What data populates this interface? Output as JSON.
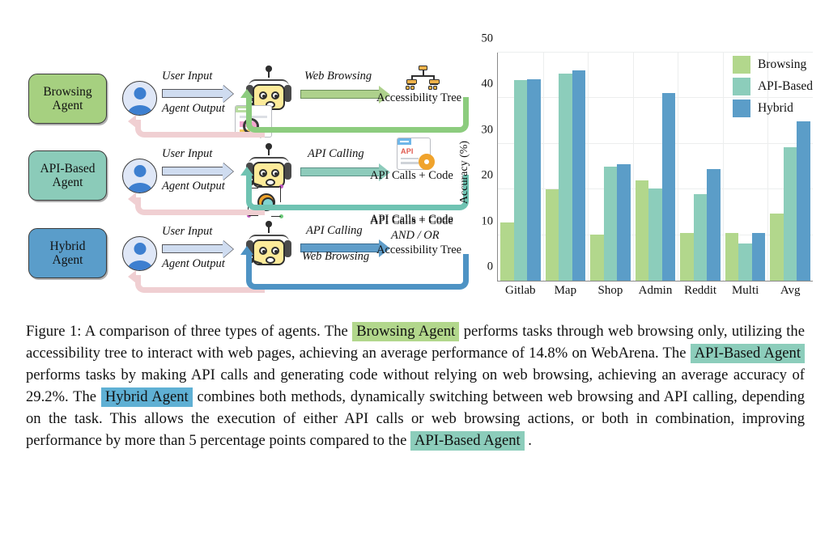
{
  "figure": {
    "diagram": {
      "agents": [
        {
          "id": "browsing",
          "label_line1": "Browsing",
          "label_line2": "Agent",
          "color": "#a6d080",
          "input_label": "User Input",
          "output_label": "Agent Output",
          "action_label": "Web Browsing",
          "action_label2": "",
          "result_line1": "Accessibility Tree",
          "result_line2": "",
          "result_line3": ""
        },
        {
          "id": "api-based",
          "label_line1": "API-Based",
          "label_line2": "Agent",
          "color": "#8bcbb9",
          "input_label": "User Input",
          "output_label": "Agent Output",
          "action_label": "API Calling",
          "action_label2": "",
          "result_line1": "API Calls + Code",
          "result_line2": "",
          "result_line3": ""
        },
        {
          "id": "hybrid",
          "label_line1": "Hybrid",
          "label_line2": "Agent",
          "color": "#5a9dca",
          "input_label": "User Input",
          "output_label": "Agent Output",
          "action_label": "API Calling",
          "action_label2": "Web Browsing",
          "result_line1": "API Calls + Code",
          "result_line2": "AND / OR",
          "result_line3": "Accessibility Tree"
        }
      ],
      "loop_return_label": "API Calls + Code",
      "icons": {
        "user": "user-avatar-icon",
        "robot": "robot-agent-icon",
        "browser": "browser-search-icon",
        "api_window": "api-code-window-icon",
        "api_gear": "api-gear-node-icon",
        "tree": "accessibility-tree-icon"
      }
    }
  },
  "chart_data": {
    "type": "bar",
    "title": "",
    "xlabel": "",
    "ylabel": "Accuracy (%)",
    "ylim": [
      0,
      50
    ],
    "yticks": [
      0,
      10,
      20,
      30,
      40,
      50
    ],
    "grid": true,
    "legend_position": "top-right",
    "categories": [
      "Gitlab",
      "Map",
      "Shop",
      "Admin",
      "Reddit",
      "Multi",
      "Avg"
    ],
    "series": [
      {
        "name": "Browsing",
        "color": "#b2d78c",
        "values": [
          12.7,
          20.1,
          10.1,
          21.9,
          10.4,
          10.4,
          14.8
        ]
      },
      {
        "name": "API-Based",
        "color": "#8ccdbb",
        "values": [
          43.9,
          45.4,
          25.0,
          20.2,
          18.9,
          8.2,
          29.2
        ]
      },
      {
        "name": "Hybrid",
        "color": "#5b9dc8",
        "values": [
          44.2,
          46.1,
          25.6,
          41.2,
          24.4,
          10.4,
          34.9
        ]
      }
    ]
  },
  "caption": {
    "s1": "Figure 1: A comparison of three types of agents. The ",
    "h1": "Browsing Agent",
    "s2": " performs tasks through web browsing only, utilizing the accessibility tree to interact with web pages, achieving an average performance of 14.8% on WebArena. The ",
    "h2": "API-Based Agent",
    "s3": " performs tasks by making API calls and generating code without relying on web browsing, achieving an average accuracy of 29.2%. The ",
    "h3": "Hybrid Agent",
    "s4": " combines both methods, dynamically switching between web browsing and API calling, depending on the task. This allows the execution of either API calls or web browsing actions, or both in combination, improving performance by more than 5 percentage points compared to the ",
    "h4": "API-Based Agent",
    "s5": " ."
  }
}
